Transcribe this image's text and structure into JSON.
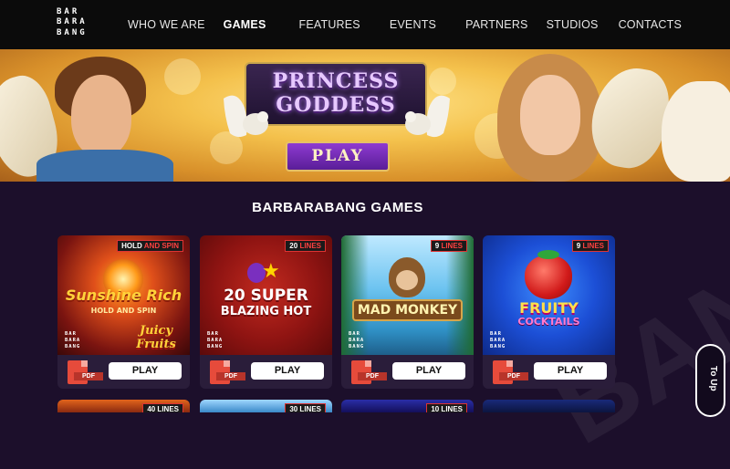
{
  "header": {
    "logo_letters": [
      "B",
      "A",
      "R",
      "B",
      "A",
      "R",
      "B",
      "A",
      "N",
      "G",
      "",
      ""
    ],
    "logo_rows": [
      "BAR",
      "BARA",
      "BANG"
    ],
    "nav": [
      {
        "label": "WHO WE ARE",
        "active": false
      },
      {
        "label": "GAMES",
        "active": true
      },
      {
        "label": "FEATURES",
        "active": false
      },
      {
        "label": "EVENTS",
        "active": false
      },
      {
        "label": "PARTNERS",
        "active": false
      },
      {
        "label": "STUDIOS",
        "active": false
      },
      {
        "label": "CONTACTS",
        "active": false
      }
    ]
  },
  "hero": {
    "game_title_line1": "PRINCESS",
    "game_title_line2": "GODDESS",
    "play_label": "PLAY"
  },
  "section": {
    "title": "BARBARABANG GAMES"
  },
  "games": [
    {
      "title_line1": "Sunshine Rich",
      "title_line2": "HOLD AND SPIN",
      "extra": "Juicy Fruits",
      "badge_white": "HOLD",
      "badge_red": "AND SPIN",
      "pdf": "PDF",
      "play": "PLAY"
    },
    {
      "title_line1": "20 SUPER",
      "title_line2": "BLAZING HOT",
      "extra": "",
      "badge_white": "20",
      "badge_red": "LINES",
      "pdf": "PDF",
      "play": "PLAY"
    },
    {
      "title_line1": "MAD MONKEY",
      "title_line2": "",
      "extra": "",
      "badge_white": "9",
      "badge_red": "LINES",
      "pdf": "PDF",
      "play": "PLAY"
    },
    {
      "title_line1": "FRUITY",
      "title_line2": "COCKTAILS",
      "extra": "",
      "badge_white": "9",
      "badge_red": "LINES",
      "pdf": "PDF",
      "play": "PLAY"
    }
  ],
  "card_logo": [
    "BAR",
    "BARA",
    "BANG"
  ],
  "next_row_badges": [
    "40 LINES",
    "30 LINES",
    "10 LINES",
    ""
  ],
  "to_top": "To Up",
  "colors": {
    "background": "#1c0f2b",
    "header": "#0b0b0b",
    "card_footer": "#2a1d3a",
    "accent_red": "#e64b3b",
    "hero_play": "#7a2fbf"
  }
}
